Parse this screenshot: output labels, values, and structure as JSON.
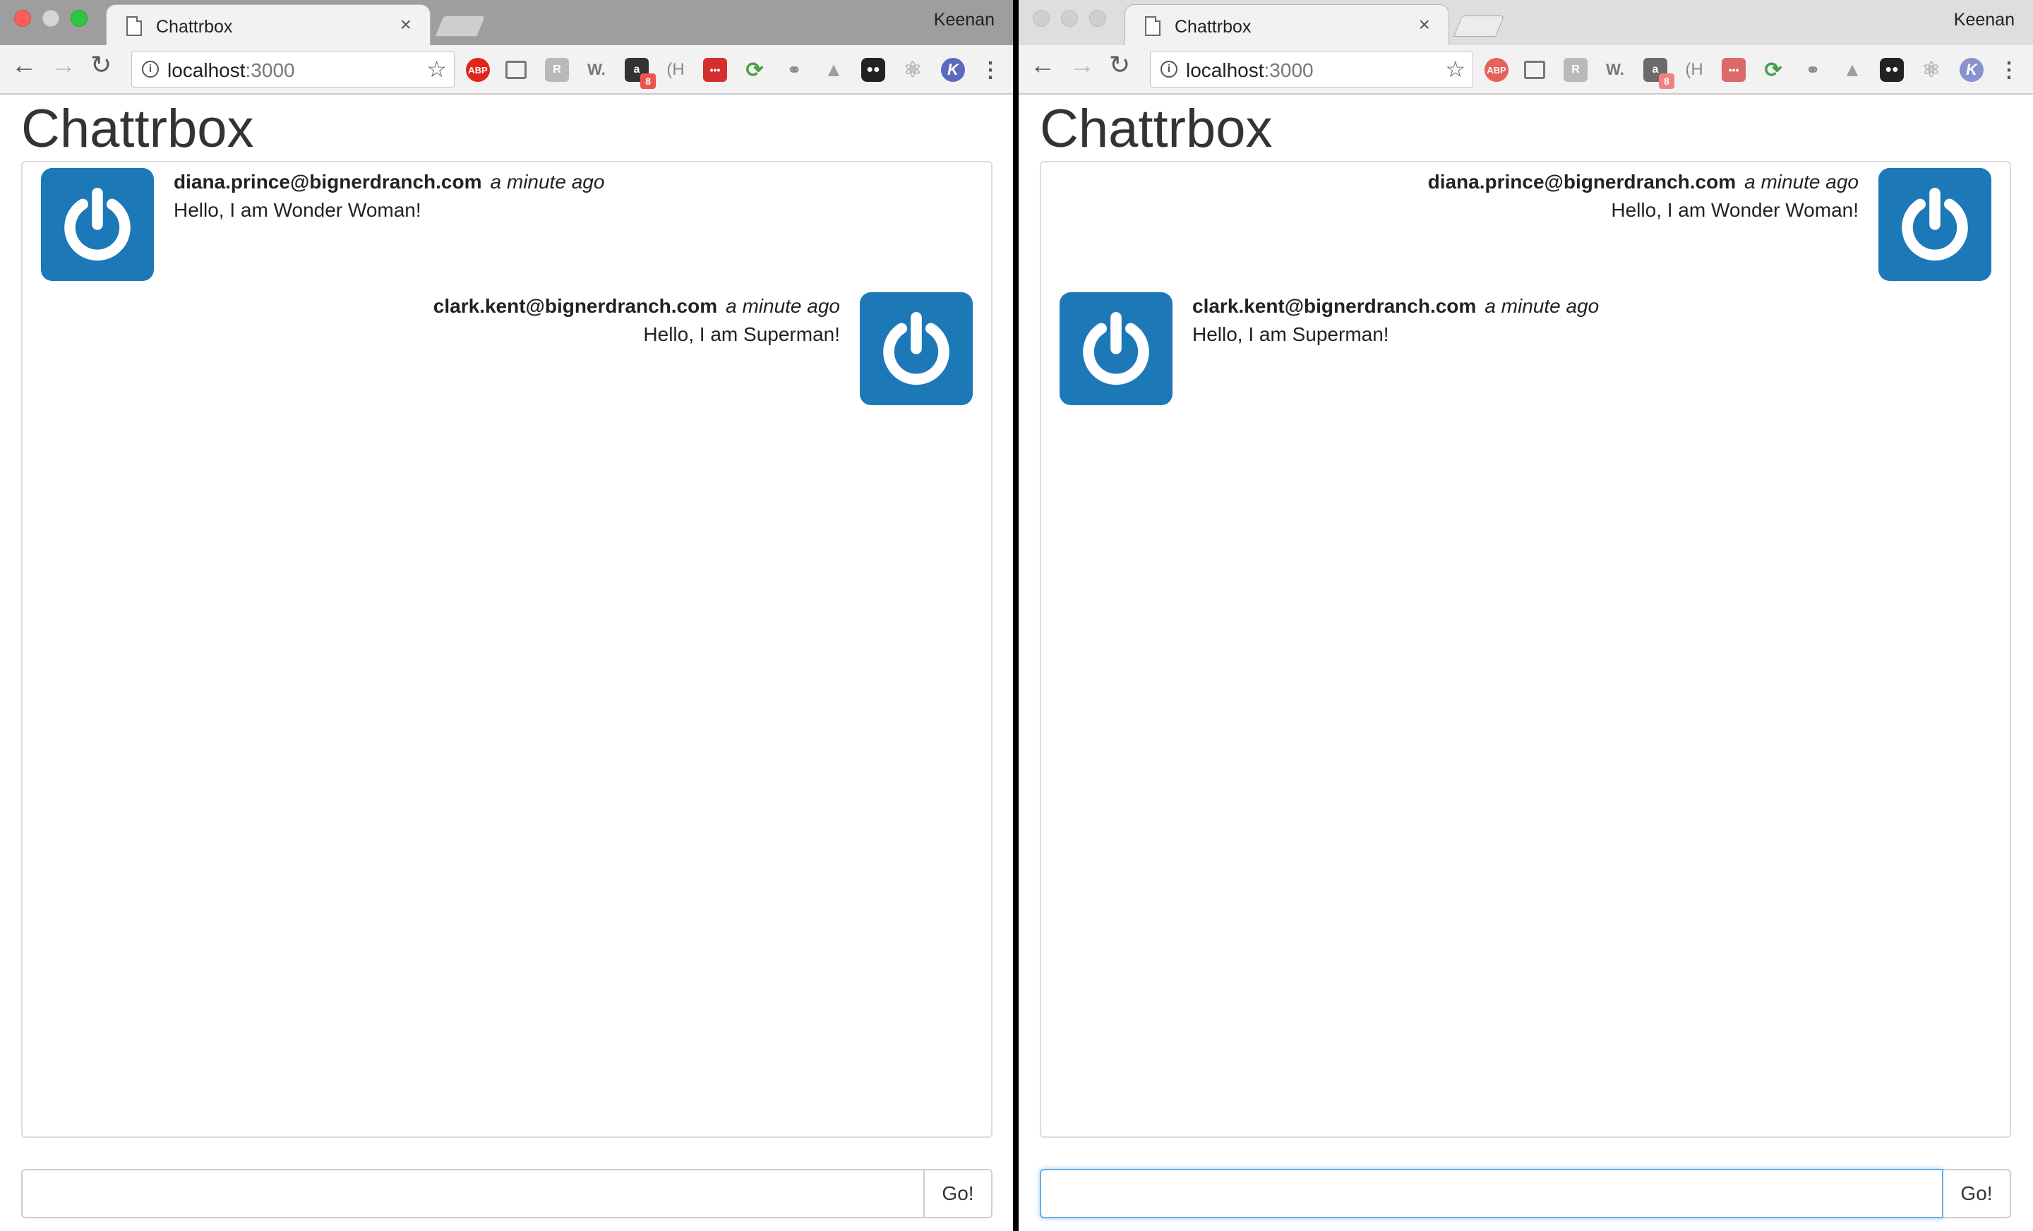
{
  "browser": {
    "tab_title": "Chattrbox",
    "tab_close": "×",
    "profile_name": "Keenan",
    "url_host": "localhost",
    "url_port": ":3000",
    "extensions": {
      "abp": "ABP",
      "amazon_badge": "8",
      "w": "W.",
      "k": "K"
    },
    "icons": {
      "back": "arrow-left",
      "forward": "arrow-right",
      "reload": "reload",
      "star": "star",
      "info": "info",
      "menu": "more-vertical"
    }
  },
  "app": {
    "title": "Chattrbox",
    "go_label": "Go!"
  },
  "windows": {
    "left": {
      "messages": [
        {
          "sender": "diana.prince@bignerdranch.com",
          "time": "a minute ago",
          "text": "Hello, I am Wonder Woman!"
        },
        {
          "sender": "clark.kent@bignerdranch.com",
          "time": "a minute ago",
          "text": "Hello, I am Superman!"
        }
      ],
      "input_value": ""
    },
    "right": {
      "messages": [
        {
          "sender": "diana.prince@bignerdranch.com",
          "time": "a minute ago",
          "text": "Hello, I am Wonder Woman!"
        },
        {
          "sender": "clark.kent@bignerdranch.com",
          "time": "a minute ago",
          "text": "Hello, I am Superman!"
        }
      ],
      "input_value": ""
    }
  },
  "colors": {
    "avatar_blue": "#1d78b8",
    "focus_blue": "#66afe9"
  }
}
